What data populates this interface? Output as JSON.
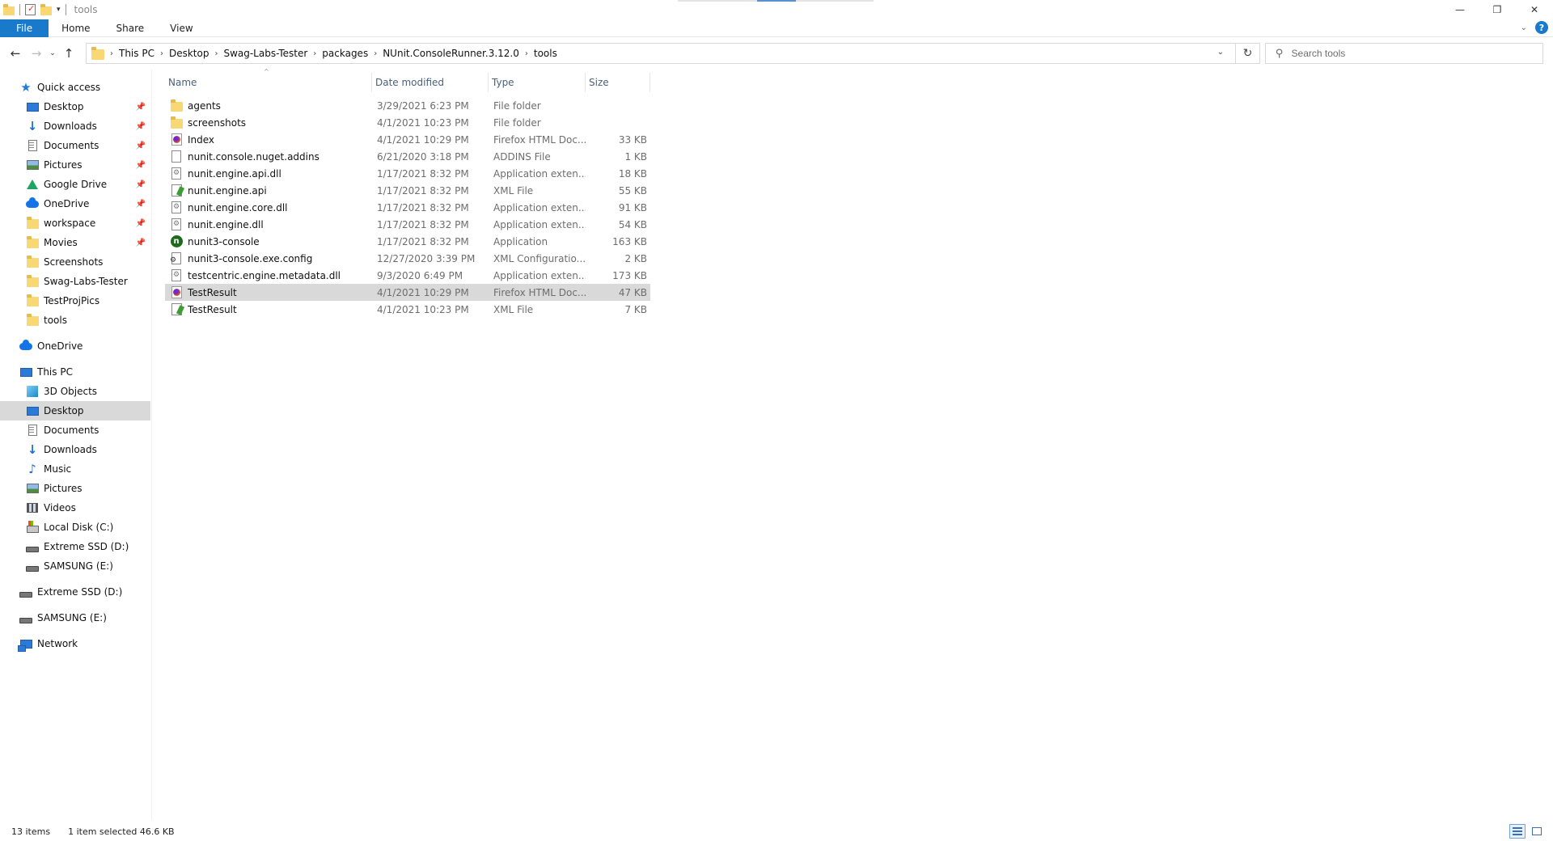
{
  "window": {
    "title": "tools",
    "controls": {
      "minimize": "—",
      "restore": "❐",
      "close": "✕"
    }
  },
  "ribbon": {
    "tabs": [
      {
        "label": "File"
      },
      {
        "label": "Home"
      },
      {
        "label": "Share"
      },
      {
        "label": "View"
      }
    ],
    "help": "?",
    "expand": "⌄"
  },
  "address": {
    "breadcrumbs": [
      "This PC",
      "Desktop",
      "Swag-Labs-Tester",
      "packages",
      "NUnit.ConsoleRunner.3.12.0",
      "tools"
    ],
    "separator": "›",
    "dropdown": "⌄",
    "refresh": "↻"
  },
  "search": {
    "placeholder": "Search tools"
  },
  "sidebar": {
    "items": [
      {
        "label": "Quick access",
        "icon": "star-icon"
      },
      {
        "label": "Desktop",
        "icon": "desktop-icon",
        "pinned": true
      },
      {
        "label": "Downloads",
        "icon": "downloads-icon",
        "pinned": true
      },
      {
        "label": "Documents",
        "icon": "documents-icon",
        "pinned": true
      },
      {
        "label": "Pictures",
        "icon": "pictures-icon",
        "pinned": true
      },
      {
        "label": "Google Drive",
        "icon": "google-drive-icon",
        "pinned": true
      },
      {
        "label": "OneDrive",
        "icon": "onedrive-icon",
        "pinned": true
      },
      {
        "label": "workspace",
        "icon": "folder-icon",
        "pinned": true
      },
      {
        "label": "Movies",
        "icon": "folder-icon",
        "pinned": true
      },
      {
        "label": "Screenshots",
        "icon": "folder-icon"
      },
      {
        "label": "Swag-Labs-Tester",
        "icon": "folder-icon"
      },
      {
        "label": "TestProjPics",
        "icon": "folder-icon"
      },
      {
        "label": "tools",
        "icon": "folder-icon"
      },
      {
        "label": "OneDrive",
        "icon": "onedrive-icon"
      },
      {
        "label": "This PC",
        "icon": "this-pc-icon"
      },
      {
        "label": "3D Objects",
        "icon": "3d-objects-icon"
      },
      {
        "label": "Desktop",
        "icon": "desktop-icon",
        "selected": true
      },
      {
        "label": "Documents",
        "icon": "documents-icon"
      },
      {
        "label": "Downloads",
        "icon": "downloads-icon"
      },
      {
        "label": "Music",
        "icon": "music-icon"
      },
      {
        "label": "Pictures",
        "icon": "pictures-icon"
      },
      {
        "label": "Videos",
        "icon": "videos-icon"
      },
      {
        "label": "Local Disk (C:)",
        "icon": "local-disk-icon"
      },
      {
        "label": "Extreme SSD (D:)",
        "icon": "drive-icon"
      },
      {
        "label": "SAMSUNG (E:)",
        "icon": "drive-icon"
      },
      {
        "label": "Extreme SSD (D:)",
        "icon": "drive-icon"
      },
      {
        "label": "SAMSUNG (E:)",
        "icon": "drive-icon"
      },
      {
        "label": "Network",
        "icon": "network-icon"
      }
    ],
    "pin_glyph": "📌"
  },
  "filelist": {
    "columns": {
      "name": "Name",
      "date": "Date modified",
      "type": "Type",
      "size": "Size"
    },
    "sort_indicator": "^",
    "rows": [
      {
        "name": "agents",
        "date": "3/29/2021 6:23 PM",
        "type": "File folder",
        "size": "",
        "icon": "folder-icon"
      },
      {
        "name": "screenshots",
        "date": "4/1/2021 10:23 PM",
        "type": "File folder",
        "size": "",
        "icon": "folder-icon"
      },
      {
        "name": "Index",
        "date": "4/1/2021 10:29 PM",
        "type": "Firefox HTML Doc...",
        "size": "33 KB",
        "icon": "firefox-html-icon"
      },
      {
        "name": "nunit.console.nuget.addins",
        "date": "6/21/2020 3:18 PM",
        "type": "ADDINS File",
        "size": "1 KB",
        "icon": "blank-file-icon"
      },
      {
        "name": "nunit.engine.api.dll",
        "date": "1/17/2021 8:32 PM",
        "type": "Application exten...",
        "size": "18 KB",
        "icon": "dll-file-icon"
      },
      {
        "name": "nunit.engine.api",
        "date": "1/17/2021 8:32 PM",
        "type": "XML File",
        "size": "55 KB",
        "icon": "xml-file-icon"
      },
      {
        "name": "nunit.engine.core.dll",
        "date": "1/17/2021 8:32 PM",
        "type": "Application exten...",
        "size": "91 KB",
        "icon": "dll-file-icon"
      },
      {
        "name": "nunit.engine.dll",
        "date": "1/17/2021 8:32 PM",
        "type": "Application exten...",
        "size": "54 KB",
        "icon": "dll-file-icon"
      },
      {
        "name": "nunit3-console",
        "date": "1/17/2021 8:32 PM",
        "type": "Application",
        "size": "163 KB",
        "icon": "nunit-app-icon"
      },
      {
        "name": "nunit3-console.exe.config",
        "date": "12/27/2020 3:39 PM",
        "type": "XML Configuratio...",
        "size": "2 KB",
        "icon": "config-file-icon"
      },
      {
        "name": "testcentric.engine.metadata.dll",
        "date": "9/3/2020 6:49 PM",
        "type": "Application exten...",
        "size": "173 KB",
        "icon": "dll-file-icon"
      },
      {
        "name": "TestResult",
        "date": "4/1/2021 10:29 PM",
        "type": "Firefox HTML Doc...",
        "size": "47 KB",
        "icon": "firefox-html-icon",
        "selected": true
      },
      {
        "name": "TestResult",
        "date": "4/1/2021 10:23 PM",
        "type": "XML File",
        "size": "7 KB",
        "icon": "xml-file-icon"
      }
    ]
  },
  "status": {
    "items_count": "13 items",
    "selection": "1 item selected  46.6 KB"
  },
  "colors": {
    "accent": "#1979ca",
    "selection": "#d9d9d9",
    "folder": "#f8d775"
  }
}
